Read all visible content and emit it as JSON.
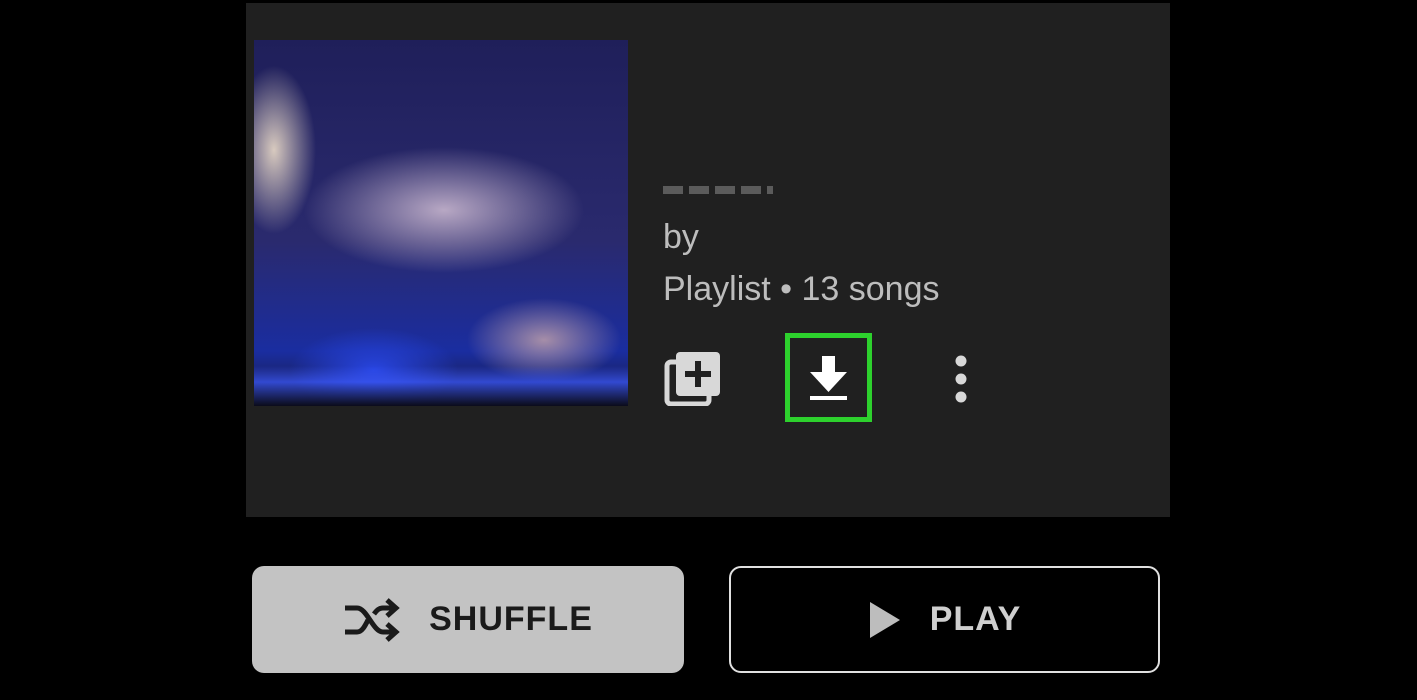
{
  "playlist": {
    "by_text": "by",
    "subtitle": "Playlist • 13 songs",
    "cover_description": "album-cover-art"
  },
  "actions": {
    "add_icon": "library-add-icon",
    "download_icon": "download-icon",
    "more_icon": "more-vert-icon",
    "highlight_color": "#2dd12d"
  },
  "buttons": {
    "shuffle_label": "SHUFFLE",
    "play_label": "PLAY"
  }
}
